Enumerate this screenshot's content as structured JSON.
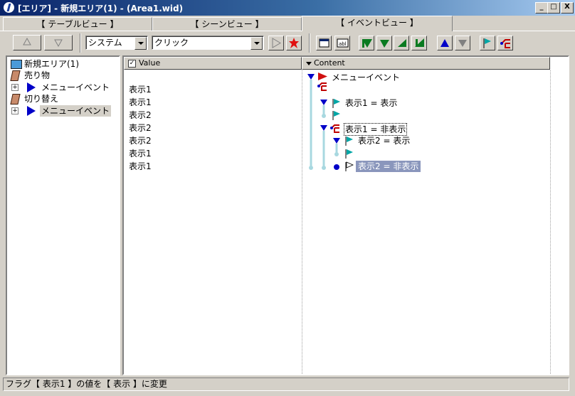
{
  "window": {
    "title": "[エリア] - 新規エリア(1) - (Area1.wid)",
    "min_label": "_",
    "max_label": "□",
    "close_label": "X"
  },
  "tabs": [
    {
      "label": "【 テーブルビュー 】"
    },
    {
      "label": "【 シーンビュー 】"
    },
    {
      "label": "【 イベントビュー 】"
    }
  ],
  "toolbar": {
    "category_select": "システム",
    "event_select": "クリック"
  },
  "tree": {
    "root": "新規エリア(1)",
    "items": [
      {
        "label": "売り物"
      },
      {
        "label": "メニューイベント"
      },
      {
        "label": "切り替え"
      },
      {
        "label": "メニューイベント"
      }
    ]
  },
  "value_panel": {
    "header": "Value",
    "rows": [
      "表示1",
      "表示1",
      "表示2",
      "表示2",
      "表示2",
      "表示1",
      "表示1"
    ]
  },
  "content_panel": {
    "header": "Content",
    "lines": [
      {
        "text": "メニューイベント"
      },
      {
        "text": ""
      },
      {
        "text": "表示1 = 表示"
      },
      {
        "text": ""
      },
      {
        "text": "表示1 = 非表示"
      },
      {
        "text": "表示2 = 表示"
      },
      {
        "text": ""
      },
      {
        "text": "表示2 = 非表示"
      }
    ]
  },
  "status": {
    "text": "フラグ【 表示1 】の値を【 表示 】に変更"
  },
  "colors": {
    "title_start": "#0a246a",
    "title_end": "#a6caf0",
    "selection": "#8a96bc",
    "connector": "#a8d8e0",
    "marker_blue": "#0000c8",
    "marker_green": "#0a7a20",
    "flag_teal": "#00a6a6"
  }
}
